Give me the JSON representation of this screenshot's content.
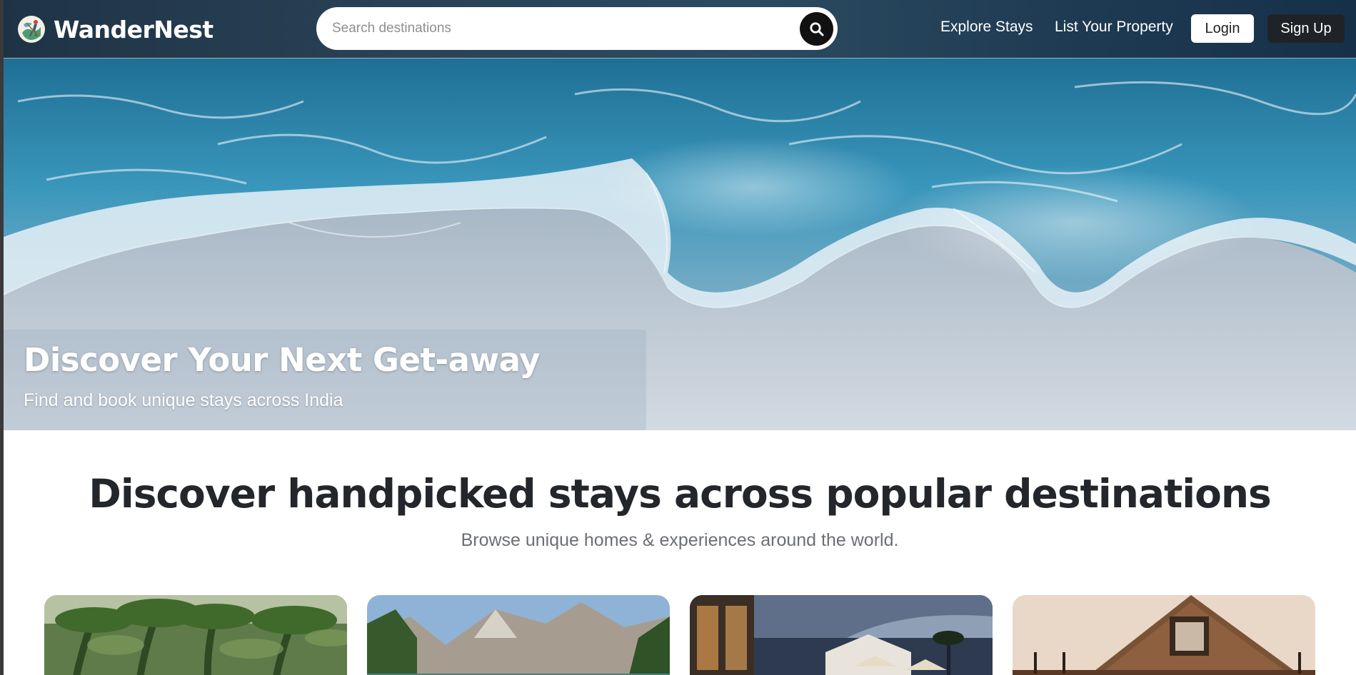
{
  "brand": {
    "name": "WanderNest",
    "logo_icon": "globe-traveler-icon"
  },
  "search": {
    "placeholder": "Search destinations",
    "button_icon": "search-icon"
  },
  "nav": {
    "explore_label": "Explore Stays",
    "list_label": "List Your Property",
    "login_label": "Login",
    "signup_label": "Sign Up"
  },
  "hero": {
    "title": "Discover Your Next Get-away",
    "subtitle": "Find and book unique stays across India"
  },
  "section": {
    "title": "Discover handpicked stays across popular destinations",
    "subtitle": "Browse unique homes & experiences around the world."
  },
  "cards": [
    {
      "image": "palm-trees-resort"
    },
    {
      "image": "mountain-lake"
    },
    {
      "image": "restaurant-terrace-evening"
    },
    {
      "image": "overwater-villa"
    }
  ],
  "colors": {
    "navbar": "#243d52",
    "signup_button": "#1f2328",
    "login_button": "#ffffff",
    "heading_text": "#23262b",
    "subtext": "#6b6f75"
  }
}
